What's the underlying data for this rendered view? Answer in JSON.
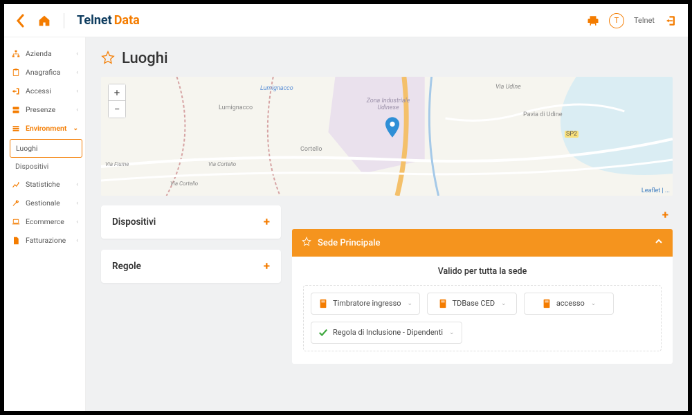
{
  "brand": {
    "part1": "Telnet",
    "part2": "Data"
  },
  "user": {
    "initial": "T",
    "name": "Telnet"
  },
  "sidebar": {
    "items": [
      {
        "label": "Azienda"
      },
      {
        "label": "Anagrafica"
      },
      {
        "label": "Accessi"
      },
      {
        "label": "Presenze"
      },
      {
        "label": "Environment",
        "active": true,
        "sub": [
          {
            "label": "Luoghi",
            "selected": true
          },
          {
            "label": "Dispositivi"
          }
        ]
      },
      {
        "label": "Statistiche"
      },
      {
        "label": "Gestionale"
      },
      {
        "label": "Ecommerce"
      },
      {
        "label": "Fatturazione"
      }
    ]
  },
  "page": {
    "title": "Luoghi"
  },
  "map": {
    "labels": {
      "lumignacco": "Lumignacco",
      "lumignacco2": "Lumignacco",
      "cortello": "Cortello",
      "zona": "Zona Industriale Udinese",
      "pavia": "Pavia di Udine",
      "sp2": "SP2",
      "via_udine": "Via Udine",
      "via_fiume": "Via Fiume",
      "via_cortello": "Via Cortello",
      "via_cortello2": "Via Cortello"
    },
    "attribution": "Leaflet | ..."
  },
  "cards": {
    "dispositivi": "Dispositivi",
    "regole": "Regole"
  },
  "sede": {
    "title": "Sede Principale",
    "subtitle": "Valido per tutta la sede",
    "chips": [
      {
        "label": "Timbratore ingresso",
        "kind": "device"
      },
      {
        "label": "TDBase CED",
        "kind": "device"
      },
      {
        "label": "accesso",
        "kind": "device"
      },
      {
        "label": "Regola di Inclusione - Dipendenti",
        "kind": "rule"
      }
    ]
  }
}
